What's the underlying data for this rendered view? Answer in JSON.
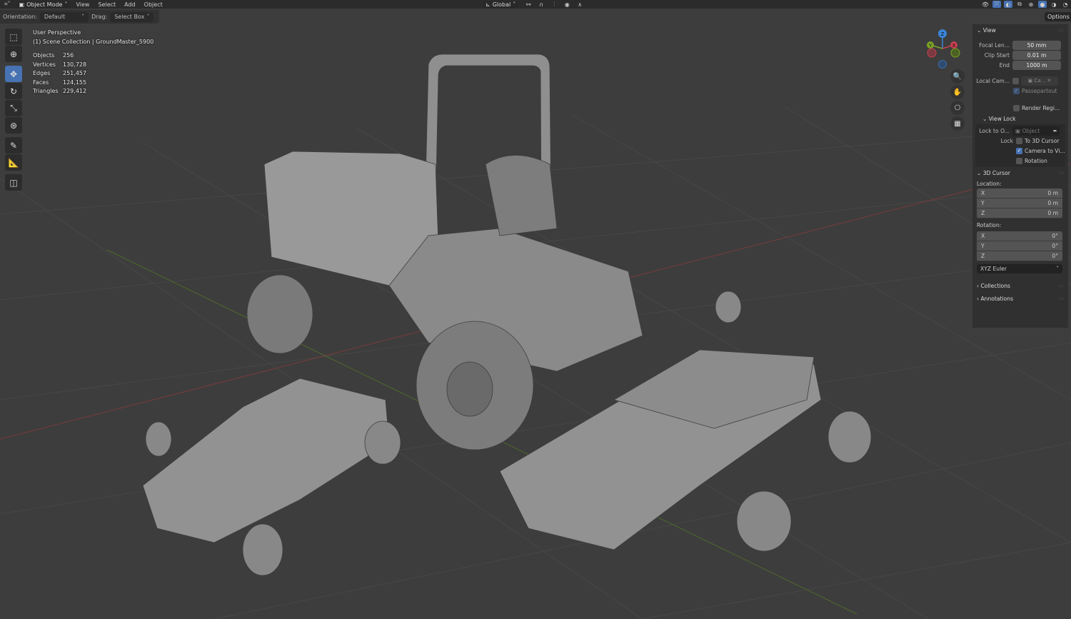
{
  "header": {
    "editor_icon": "editor-type-icon",
    "mode": "Object Mode",
    "menus": [
      "View",
      "Select",
      "Add",
      "Object"
    ],
    "transform_orientation": "Global"
  },
  "tool_settings": {
    "orientation_label": "Orientation:",
    "orientation_value": "Default",
    "drag_label": "Drag:",
    "drag_value": "Select Box",
    "options": "Options"
  },
  "overlay": {
    "view_name": "User Perspective",
    "collection": "(1) Scene Collection | GroundMaster_5900",
    "stats": [
      {
        "k": "Objects",
        "v": "256"
      },
      {
        "k": "Vertices",
        "v": "130,728"
      },
      {
        "k": "Edges",
        "v": "251,457"
      },
      {
        "k": "Faces",
        "v": "124,155"
      },
      {
        "k": "Triangles",
        "v": "229,412"
      }
    ]
  },
  "gizmo": {
    "z": "Z",
    "y": "Y",
    "x": "X",
    "colors": {
      "x": "#c8404f",
      "y": "#7ba428",
      "z": "#3b85d8"
    }
  },
  "npanel": {
    "view": {
      "title": "View",
      "focal_label": "Focal Len...",
      "focal": "50 mm",
      "clip_start_label": "Clip Start",
      "clip_start": "0.01 m",
      "end_label": "End",
      "end": "1000 m",
      "local_cam_label": "Local Cam...",
      "local_cam": "Ca...",
      "passepartout": "Passepartout",
      "render_region": "Render Regi..."
    },
    "view_lock": {
      "title": "View Lock",
      "lock_to_label": "Lock to O...",
      "lock_to": "Object",
      "lock_label": "Lock",
      "to_cursor": "To 3D Cursor",
      "camera_to_view": "Camera to Vi...",
      "rotation": "Rotation"
    },
    "cursor": {
      "title": "3D Cursor",
      "location_label": "Location:",
      "loc": [
        {
          "a": "X",
          "v": "0 m"
        },
        {
          "a": "Y",
          "v": "0 m"
        },
        {
          "a": "Z",
          "v": "0 m"
        }
      ],
      "rotation_label": "Rotation:",
      "rot": [
        {
          "a": "X",
          "v": "0°"
        },
        {
          "a": "Y",
          "v": "0°"
        },
        {
          "a": "Z",
          "v": "0°"
        }
      ],
      "mode": "XYZ Euler"
    },
    "collections": "Collections",
    "annotations": "Annotations"
  },
  "accent": "#4772b3"
}
